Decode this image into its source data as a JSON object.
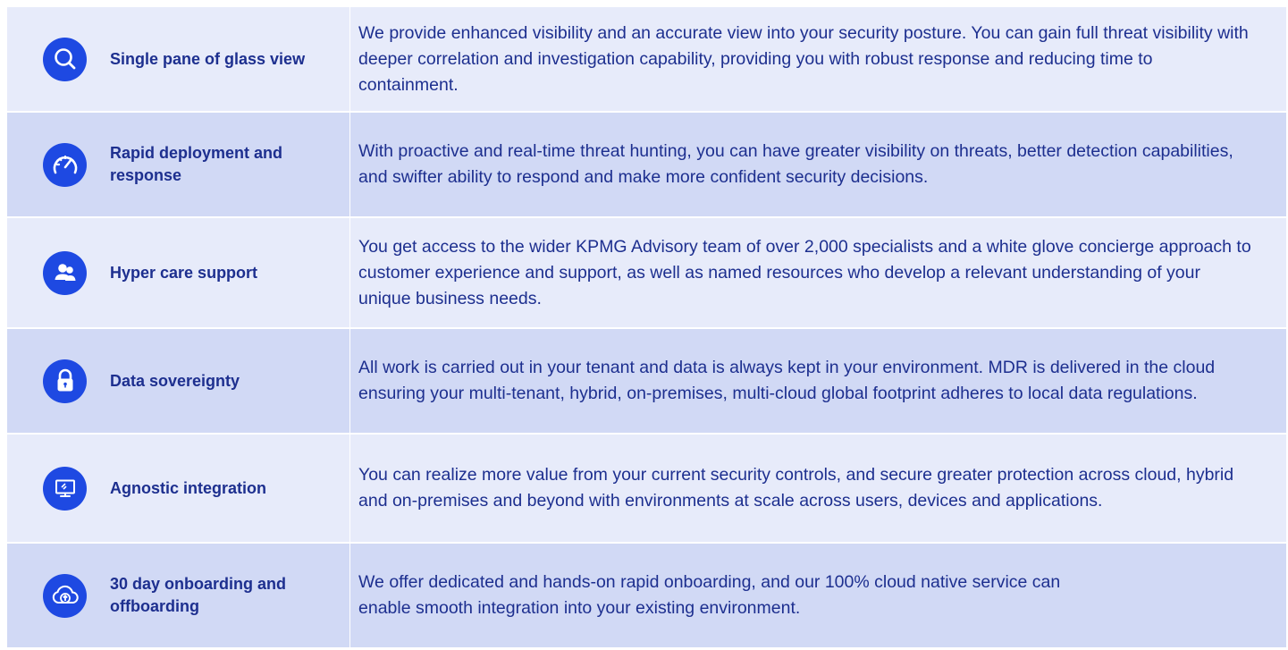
{
  "rows": [
    {
      "title": "Single pane of glass view",
      "description": "We provide enhanced visibility and an accurate view into your security posture. You can gain full threat visibility with deeper correlation and investigation capability, providing you with robust response and reducing time to containment.",
      "icon": "search-icon"
    },
    {
      "title": "Rapid deployment and response",
      "description": "With proactive and real-time threat hunting, you can have greater visibility on threats, better detection capabilities, and swifter ability to respond and make more confident security decisions.",
      "icon": "speedometer-icon"
    },
    {
      "title": "Hyper care support",
      "description": "You get access to the wider KPMG Advisory team of over 2,000 specialists and a white glove concierge approach to customer experience and support, as well as named resources who develop a relevant understanding of your unique business needs.",
      "icon": "people-icon"
    },
    {
      "title": "Data sovereignty",
      "description": "All work is carried out in your tenant and data is always kept in your environment. MDR is delivered in the cloud ensuring your multi-tenant, hybrid, on-premises, multi-cloud global footprint adheres to local data regulations.",
      "icon": "lock-icon"
    },
    {
      "title": "Agnostic integration",
      "description": "You can realize more value from your current security controls, and secure greater protection across cloud, hybrid and on-premises and beyond with environments at scale across users, devices and applications.",
      "icon": "monitor-icon"
    },
    {
      "title": "30 day onboarding and offboarding",
      "description": "We offer dedicated and hands-on rapid onboarding, and our 100% cloud native service can enable smooth integration into your existing environment.",
      "icon": "cloud-upload-icon"
    }
  ],
  "colors": {
    "icon_bg": "#1e49e2",
    "text": "#1d2f8f",
    "row_light": "#e7ebfa",
    "row_dark": "#d1d9f5"
  }
}
